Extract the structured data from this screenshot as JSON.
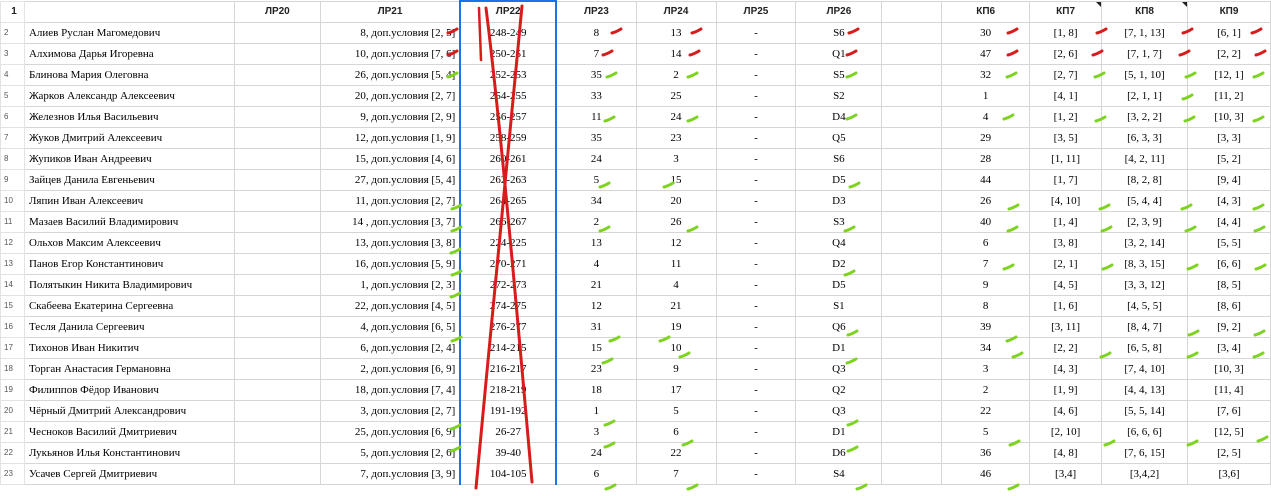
{
  "headers": [
    "",
    "",
    "ЛР20",
    "ЛР21",
    "ЛР22",
    "ЛР23",
    "ЛР24",
    "ЛР25",
    "ЛР26",
    "",
    "КП6",
    "КП7",
    "КП8",
    "КП9"
  ],
  "header_row_number": "1",
  "rows": [
    {
      "n": "2",
      "name": "Алиев Руслан Магомедович",
      "lr20": "",
      "lr21": "8, доп.условия [2, 5]",
      "lr22": "248-249",
      "lr23": "8",
      "lr24": "13",
      "lr25": "-",
      "lr26": "S6",
      "kp6": "30",
      "kp7": "[1, 8]",
      "kp8": "[7, 1, 13]",
      "kp9": "[6, 1]"
    },
    {
      "n": "3",
      "name": "Алхимова Дарья Игоревна",
      "lr20": "",
      "lr21": "10, доп.условия [7, 6]",
      "lr22": "250-251",
      "lr23": "7",
      "lr24": "14",
      "lr25": "-",
      "lr26": "Q1",
      "kp6": "47",
      "kp7": "[2, 6]",
      "kp8": "[7, 1, 7]",
      "kp9": "[2, 2]"
    },
    {
      "n": "4",
      "name": "Блинова Мария Олеговна",
      "lr20": "",
      "lr21": "26, доп.условия [5, 4]",
      "lr22": "252-253",
      "lr23": "35",
      "lr24": "2",
      "lr25": "-",
      "lr26": "S5",
      "kp6": "32",
      "kp7": "[2, 7]",
      "kp8": "[5, 1, 10]",
      "kp9": "[12, 1]"
    },
    {
      "n": "5",
      "name": "Жарков Александр Алексеевич",
      "lr20": "",
      "lr21": "20, доп.условия [2, 7]",
      "lr22": "254-255",
      "lr23": "33",
      "lr24": "25",
      "lr25": "-",
      "lr26": "S2",
      "kp6": "1",
      "kp7": "[4, 1]",
      "kp8": "[2, 1, 1]",
      "kp9": "[11, 2]"
    },
    {
      "n": "6",
      "name": "Железнов Илья Васильевич",
      "lr20": "",
      "lr21": "9, доп.условия [2, 9]",
      "lr22": "256-257",
      "lr23": "11",
      "lr24": "24",
      "lr25": "-",
      "lr26": "D4",
      "kp6": "4",
      "kp7": "[1, 2]",
      "kp8": "[3, 2, 2]",
      "kp9": "[10, 3]"
    },
    {
      "n": "7",
      "name": "Жуков Дмитрий Алексеевич",
      "lr20": "",
      "lr21": "12, доп.условия [1, 9]",
      "lr22": "258-259",
      "lr23": "35",
      "lr24": "23",
      "lr25": "-",
      "lr26": "Q5",
      "kp6": "29",
      "kp7": "[3, 5]",
      "kp8": "[6, 3, 3]",
      "kp9": "[3, 3]"
    },
    {
      "n": "8",
      "name": "Жупиков Иван Андреевич",
      "lr20": "",
      "lr21": "15, доп.условия [4, 6]",
      "lr22": "260-261",
      "lr23": "24",
      "lr24": "3",
      "lr25": "-",
      "lr26": "S6",
      "kp6": "28",
      "kp7": "[1, 11]",
      "kp8": "[4, 2, 11]",
      "kp9": "[5, 2]"
    },
    {
      "n": "9",
      "name": "Зайцев Данила Евгеньевич",
      "lr20": "",
      "lr21": "27, доп.условия [5, 4]",
      "lr22": "262-263",
      "lr23": "5",
      "lr24": "15",
      "lr25": "-",
      "lr26": "D5",
      "kp6": "44",
      "kp7": "[1, 7]",
      "kp8": "[8, 2, 8]",
      "kp9": "[9, 4]"
    },
    {
      "n": "10",
      "name": "Ляпин Иван Алексеевич",
      "lr20": "",
      "lr21": "11, доп.условия [2, 7]",
      "lr22": "264-265",
      "lr23": "34",
      "lr24": "20",
      "lr25": "-",
      "lr26": "D3",
      "kp6": "26",
      "kp7": "[4, 10]",
      "kp8": "[5, 4, 4]",
      "kp9": "[4, 3]"
    },
    {
      "n": "11",
      "name": "Мазаев Василий Владимирович",
      "lr20": "",
      "lr21": "14 , доп.условия [3, 7]",
      "lr22": "266-267",
      "lr23": "2",
      "lr24": "26",
      "lr25": "-",
      "lr26": "S3",
      "kp6": "40",
      "kp7": "[1, 4]",
      "kp8": "[2, 3, 9]",
      "kp9": "[4, 4]"
    },
    {
      "n": "12",
      "name": "Ольхов Максим Алексеевич",
      "lr20": "",
      "lr21": "13, доп.условия [3, 8]",
      "lr22": "224-225",
      "lr23": "13",
      "lr24": "12",
      "lr25": "-",
      "lr26": "Q4",
      "kp6": "6",
      "kp7": "[3, 8]",
      "kp8": "[3, 2, 14]",
      "kp9": "[5, 5]"
    },
    {
      "n": "13",
      "name": "Панов Егор Константинович",
      "lr20": "",
      "lr21": "16, доп.условия [5, 9]",
      "lr22": "270-271",
      "lr23": "4",
      "lr24": "11",
      "lr25": "-",
      "lr26": "D2",
      "kp6": "7",
      "kp7": "[2, 1]",
      "kp8": "[8, 3, 15]",
      "kp9": "[6, 6]"
    },
    {
      "n": "14",
      "name": "Полятыкин Никита Владимирович",
      "lr20": "",
      "lr21": "1, доп.условия [2, 3]",
      "lr22": "272-273",
      "lr23": "21",
      "lr24": "4",
      "lr25": "-",
      "lr26": "D5",
      "kp6": "9",
      "kp7": "[4, 5]",
      "kp8": "[3, 3, 12]",
      "kp9": "[8, 5]"
    },
    {
      "n": "15",
      "name": "Скабеева Екатерина Сергеевна",
      "lr20": "",
      "lr21": "22, доп.условия [4, 5]",
      "lr22": "274-275",
      "lr23": "12",
      "lr24": "21",
      "lr25": "-",
      "lr26": "S1",
      "kp6": "8",
      "kp7": "[1, 6]",
      "kp8": "[4, 5, 5]",
      "kp9": "[8, 6]"
    },
    {
      "n": "16",
      "name": "Тесля Данила Сергеевич",
      "lr20": "",
      "lr21": "4, доп.условия [6, 5]",
      "lr22": "276-277",
      "lr23": "31",
      "lr24": "19",
      "lr25": "-",
      "lr26": "Q6",
      "kp6": "39",
      "kp7": "[3, 11]",
      "kp8": "[8, 4, 7]",
      "kp9": "[9, 2]"
    },
    {
      "n": "17",
      "name": "Тихонов Иван Никитич",
      "lr20": "",
      "lr21": "6, доп.условия [2, 4]",
      "lr22": "214-215",
      "lr23": "15",
      "lr24": "10",
      "lr25": "-",
      "lr26": "D1",
      "kp6": "34",
      "kp7": "[2, 2]",
      "kp8": "[6, 5, 8]",
      "kp9": "[3, 4]"
    },
    {
      "n": "18",
      "name": "Торган Анастасия Германовна",
      "lr20": "",
      "lr21": "2, доп.условия [6, 9]",
      "lr22": "216-217",
      "lr23": "23",
      "lr24": "9",
      "lr25": "-",
      "lr26": "Q3",
      "kp6": "3",
      "kp7": "[4, 3]",
      "kp8": "[7, 4, 10]",
      "kp9": "[10, 3]"
    },
    {
      "n": "19",
      "name": "Филиппов Фёдор Иванович",
      "lr20": "",
      "lr21": "18, доп.условия [7, 4]",
      "lr22": "218-219",
      "lr23": "18",
      "lr24": "17",
      "lr25": "-",
      "lr26": "Q2",
      "kp6": "2",
      "kp7": "[1, 9]",
      "kp8": "[4, 4, 13]",
      "kp9": "[11, 4]"
    },
    {
      "n": "20",
      "name": "Чёрный Дмитрий Александрович",
      "lr20": "",
      "lr21": "3, доп.условия [2, 7]",
      "lr22": "191-192",
      "lr23": "1",
      "lr24": "5",
      "lr25": "-",
      "lr26": "Q3",
      "kp6": "22",
      "kp7": "[4, 6]",
      "kp8": "[5, 5, 14]",
      "kp9": "[7, 6]"
    },
    {
      "n": "21",
      "name": "Чесноков Василий Дмитриевич",
      "lr20": "",
      "lr21": "25, доп.условия [6, 9]",
      "lr22": "26-27",
      "lr23": "3",
      "lr24": "6",
      "lr25": "-",
      "lr26": "D1",
      "kp6": "5",
      "kp7": "[2, 10]",
      "kp8": "[6, 6, 6]",
      "kp9": "[12, 5]"
    },
    {
      "n": "22",
      "name": "Лукьянов Илья Константинович",
      "lr20": "",
      "lr21": "5, доп.условия [2, 6]",
      "lr22": "39-40",
      "lr23": "24",
      "lr24": "22",
      "lr25": "-",
      "lr26": "D6",
      "kp6": "36",
      "kp7": "[4, 8]",
      "kp8": "[7, 6, 15]",
      "kp9": "[2, 5]"
    },
    {
      "n": "23",
      "name": "Усачев Сергей Дмитриевич",
      "lr20": "",
      "lr21": "7, доп.условия [3, 9]",
      "lr22": "104-105",
      "lr23": "6",
      "lr24": "7",
      "lr25": "-",
      "lr26": "S4",
      "kp6": "46",
      "kp7": "[3,4]",
      "kp8": "[3,4,2]",
      "kp9": "[3,6]"
    }
  ],
  "annotations": {
    "red_mark_color": "#d81b1b",
    "green_mark_color": "#7ed321"
  }
}
